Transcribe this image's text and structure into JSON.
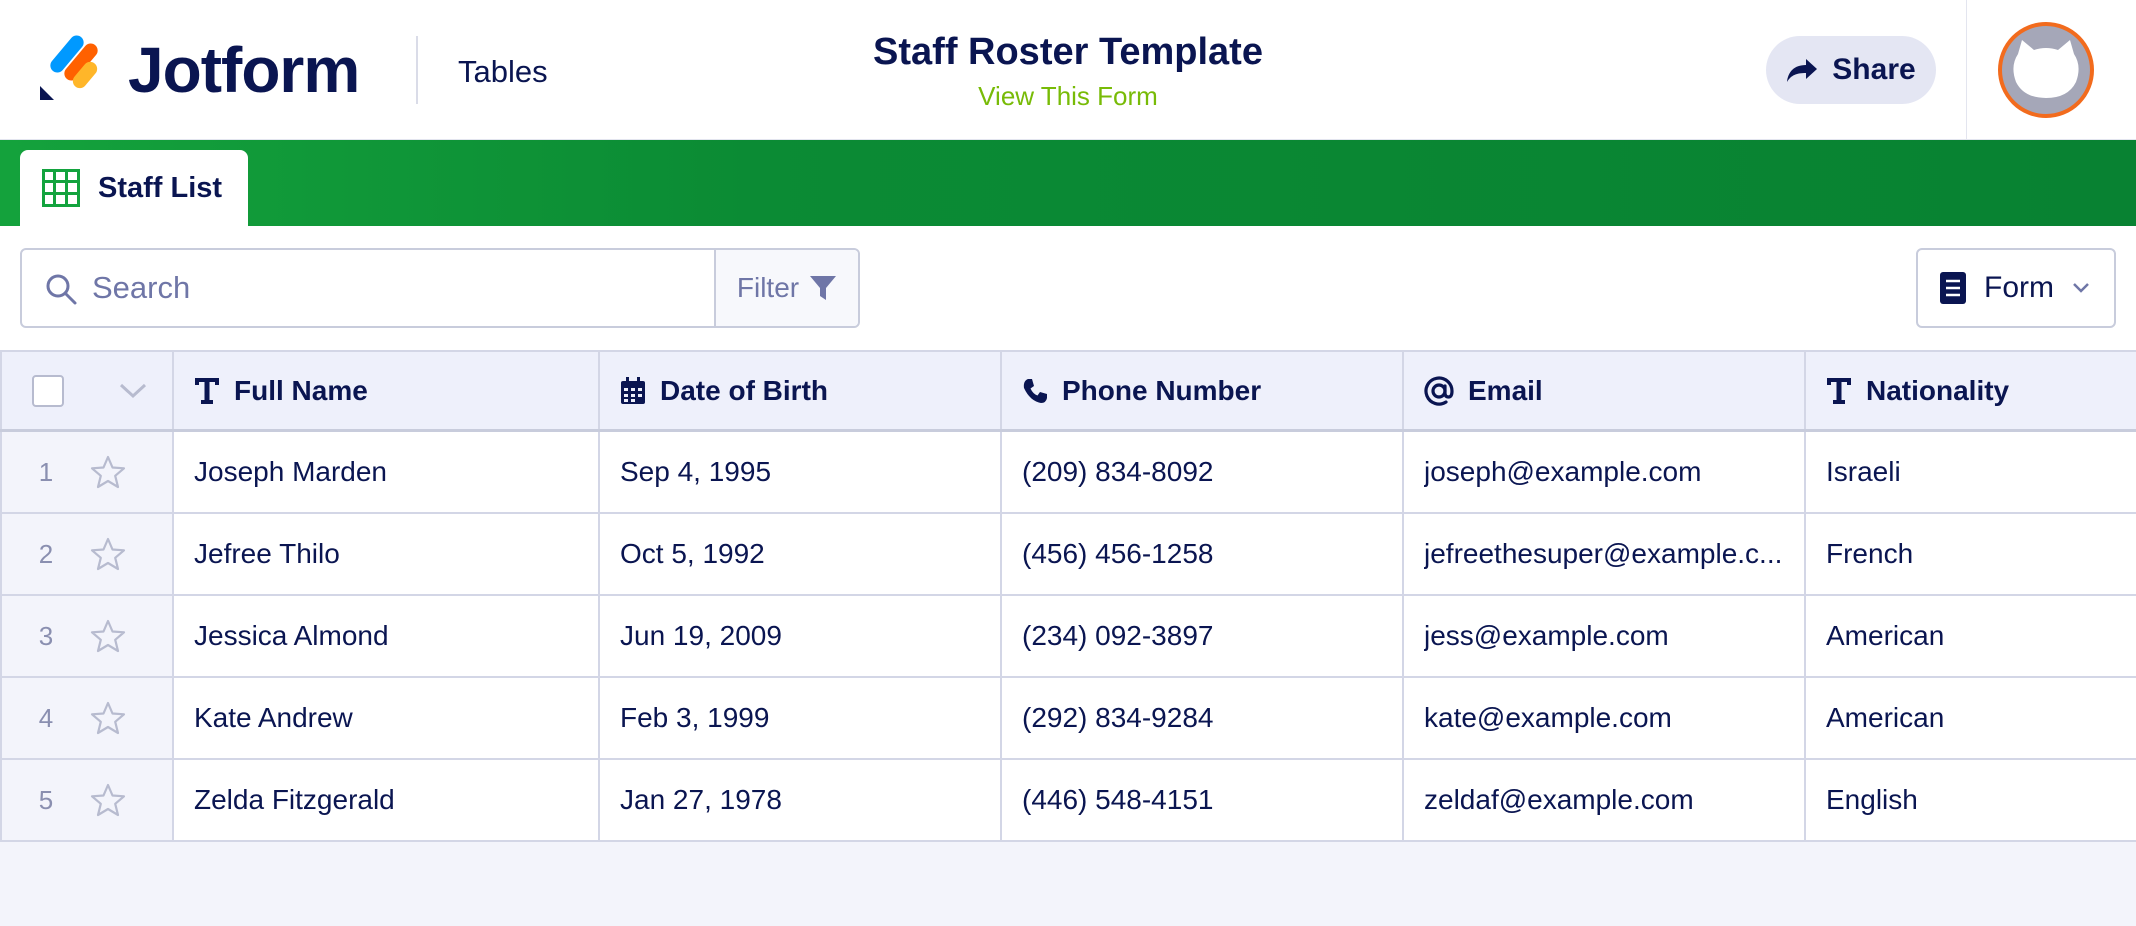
{
  "header": {
    "brand": "Jotform",
    "section": "Tables",
    "title": "Staff Roster Template",
    "subtitle_link": "View This Form",
    "share_label": "Share"
  },
  "tabs": [
    {
      "label": "Staff List",
      "icon": "grid-table-icon",
      "active": true
    }
  ],
  "toolbar": {
    "search_placeholder": "Search",
    "filter_label": "Filter",
    "form_label": "Form"
  },
  "table": {
    "columns": [
      {
        "label": "Full Name",
        "icon": "text-type-icon"
      },
      {
        "label": "Date of Birth",
        "icon": "calendar-icon"
      },
      {
        "label": "Phone Number",
        "icon": "phone-icon"
      },
      {
        "label": "Email",
        "icon": "at-sign-icon"
      },
      {
        "label": "Nationality",
        "icon": "text-type-icon"
      }
    ],
    "rows": [
      {
        "num": "1",
        "name": "Joseph Marden",
        "dob": "Sep 4, 1995",
        "phone": "(209) 834-8092",
        "email": "joseph@example.com",
        "nationality": "Israeli"
      },
      {
        "num": "2",
        "name": "Jefree Thilo",
        "dob": "Oct 5, 1992",
        "phone": "(456) 456-1258",
        "email": "jefreethesuper@example.c...",
        "nationality": "French"
      },
      {
        "num": "3",
        "name": "Jessica Almond",
        "dob": "Jun 19, 2009",
        "phone": "(234) 092-3897",
        "email": "jess@example.com",
        "nationality": "American"
      },
      {
        "num": "4",
        "name": "Kate Andrew",
        "dob": "Feb 3, 1999",
        "phone": "(292) 834-9284",
        "email": "kate@example.com",
        "nationality": "American"
      },
      {
        "num": "5",
        "name": "Zelda Fitzgerald",
        "dob": "Jan 27, 1978",
        "phone": "(446) 548-4151",
        "email": "zeldaf@example.com",
        "nationality": "English"
      }
    ]
  },
  "colors": {
    "navy": "#0a1551",
    "green_bar": "#0b8b34",
    "link_green": "#78bb07",
    "avatar_border": "#f26b1d"
  }
}
